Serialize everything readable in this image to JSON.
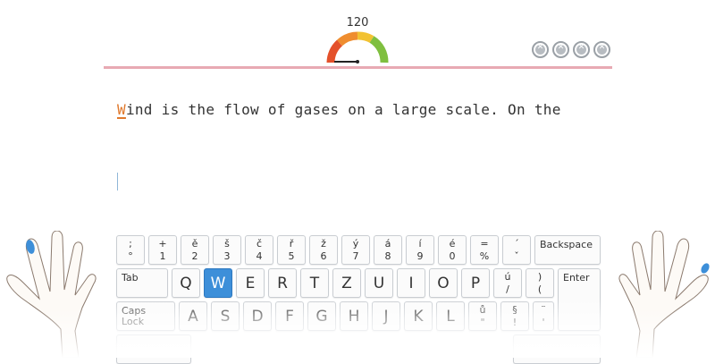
{
  "speed": {
    "value": "120"
  },
  "errors": {
    "count": 4
  },
  "text": {
    "current_char": "W",
    "rest_of_line": "ind is the flow of gases on a large scale. On the"
  },
  "keyboard": {
    "row1": [
      {
        "top": ";",
        "bottom": "°"
      },
      {
        "top": "+",
        "bottom": "1"
      },
      {
        "top": "ě",
        "bottom": "2"
      },
      {
        "top": "š",
        "bottom": "3"
      },
      {
        "top": "č",
        "bottom": "4"
      },
      {
        "top": "ř",
        "bottom": "5"
      },
      {
        "top": "ž",
        "bottom": "6"
      },
      {
        "top": "ý",
        "bottom": "7"
      },
      {
        "top": "á",
        "bottom": "8"
      },
      {
        "top": "í",
        "bottom": "9"
      },
      {
        "top": "é",
        "bottom": "0"
      },
      {
        "top": "=",
        "bottom": "%"
      },
      {
        "top": "´",
        "bottom": "ˇ"
      }
    ],
    "backspace": "Backspace",
    "tab": "Tab",
    "row2": [
      "Q",
      "W",
      "E",
      "R",
      "T",
      "Z",
      "U",
      "I",
      "O",
      "P"
    ],
    "row2_extra": [
      {
        "top": "ú",
        "bottom": "/"
      },
      {
        "top": ")",
        "bottom": "("
      }
    ],
    "enter": "Enter",
    "caps": "Caps Lock",
    "row3": [
      "A",
      "S",
      "D",
      "F",
      "G",
      "H",
      "J",
      "K",
      "L"
    ],
    "row3_extra": [
      {
        "top": "ů",
        "bottom": "\""
      },
      {
        "top": "§",
        "bottom": "!"
      },
      {
        "top": "¨",
        "bottom": "'"
      }
    ],
    "active_key": "W"
  },
  "colors": {
    "active_key": "#3d8fd9",
    "finger_highlight": "#3d8fd9",
    "progress_line": "#e8aab3",
    "current_char": "#e0782b"
  }
}
